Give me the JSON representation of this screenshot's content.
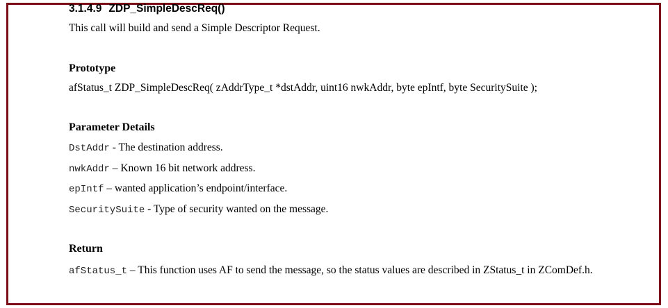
{
  "section": {
    "number": "3.1.4.9",
    "title": "ZDP_SimpleDescReq()",
    "intro": "This call will build and send a Simple Descriptor Request."
  },
  "prototype": {
    "heading": "Prototype",
    "signature": "afStatus_t ZDP_SimpleDescReq(  zAddrType_t *dstAddr, uint16 nwkAddr, byte epIntf, byte SecuritySuite );"
  },
  "parameters": {
    "heading": "Parameter Details",
    "items": [
      {
        "name": "DstAddr",
        "desc": " - The destination address."
      },
      {
        "name": "nwkAddr",
        "desc": "– Known 16 bit network address."
      },
      {
        "name": "epIntf",
        "desc": "– wanted application’s endpoint/interface."
      },
      {
        "name": "SecuritySuite",
        "desc": " - Type of security wanted on the message."
      }
    ]
  },
  "return": {
    "heading": "Return",
    "type": "afStatus_t",
    "desc": " – This function uses AF to send the message, so the status values are described in ZStatus_t in ZComDef.h."
  },
  "colors": {
    "border": "#7a0f16"
  }
}
